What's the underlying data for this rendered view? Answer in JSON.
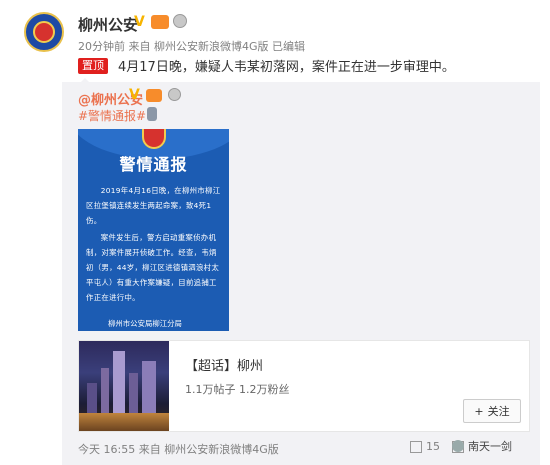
{
  "post": {
    "username": "柳州公安",
    "meta": "20分钟前 来自 柳州公安新浪微博4G版  已编辑",
    "top_tag": "置顶",
    "text": "4月17日晚，嫌疑人韦某初落网，案件正在进一步审理中。"
  },
  "repost": {
    "username": "@柳州公安",
    "topic": "#警情通报#",
    "notice": {
      "title": "警情通报",
      "paragraphs": [
        "2019年4月16日晚，在柳州市柳江区拉堡镇连续发生两起命案，致4死1伤。",
        "案件发生后，警方启动重案侦办机制，对案件展开侦破工作。经查，韦炳初（男，44岁，柳江区进德镇泗浪村太平屯人）有重大作案嫌疑，目前追捕工作正在进行中。"
      ],
      "footer": "柳州市公安局柳江分局"
    },
    "card": {
      "title": "【超话】柳州",
      "stats": "1.1万帖子 1.2万粉丝",
      "follow_label": "关注",
      "follow_icon": "plus-icon"
    },
    "footer": "今天 16:55 来自 柳州公安新浪微博4G版",
    "actions": {
      "share_count": "15",
      "share_icon": "share-icon",
      "comment_icon": "comment-icon"
    },
    "watermark": "南天一剑"
  },
  "colors": {
    "accent": "#eb7350",
    "notice_bg": "#1c5cb3",
    "top_tag_bg": "#e0201e"
  }
}
